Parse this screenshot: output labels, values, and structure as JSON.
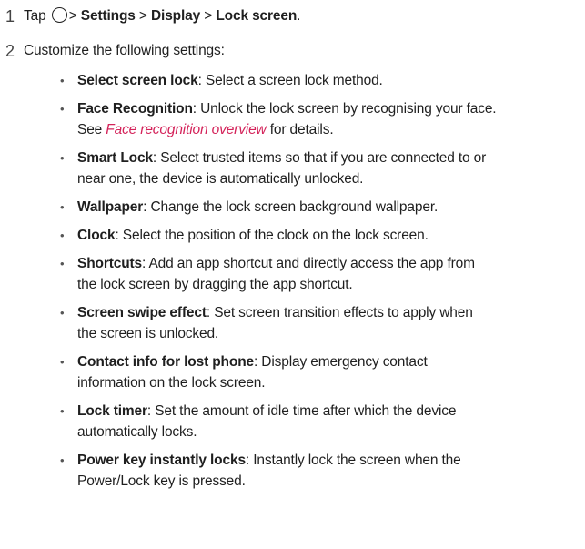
{
  "steps": [
    {
      "number": "1",
      "prefix": "Tap",
      "icon": "home-circle-icon",
      "separator": ">",
      "path": [
        "Settings",
        "Display",
        "Lock screen"
      ],
      "suffix": "."
    },
    {
      "number": "2",
      "text": "Customize the following settings:"
    }
  ],
  "items": [
    {
      "title": "Select screen lock",
      "text": ": Select a screen lock method."
    },
    {
      "title": "Face Recognition",
      "text": ": Unlock the lock screen by recognising your face.",
      "line2_prefix": "See ",
      "link": "Face recognition overview",
      "line2_suffix": " for details."
    },
    {
      "title": "Smart Lock",
      "text": ": Select trusted items so that if you are connected to or",
      "line2": "near one, the device is automatically unlocked."
    },
    {
      "title": "Wallpaper",
      "text": ": Change the lock screen background wallpaper."
    },
    {
      "title": "Clock",
      "text": ": Select the position of the clock on the lock screen."
    },
    {
      "title": "Shortcuts",
      "text": ": Add an app shortcut and directly access the app from",
      "line2": "the lock screen by dragging the app shortcut."
    },
    {
      "title": "Screen swipe effect",
      "text": ": Set screen transition effects to apply when",
      "line2": "the screen is unlocked."
    },
    {
      "title": "Contact info for lost phone",
      "text": ": Display emergency contact",
      "line2": "information on the lock screen."
    },
    {
      "title": "Lock timer",
      "text": ": Set the amount of idle time after which the device",
      "line2": "automatically locks."
    },
    {
      "title": "Power key instantly locks",
      "text": ": Instantly lock the screen when the",
      "line2": "Power/Lock key is pressed."
    }
  ],
  "bullet_symbol": "•",
  "colors": {
    "link": "#d4235a",
    "text": "#1f1f1f"
  }
}
